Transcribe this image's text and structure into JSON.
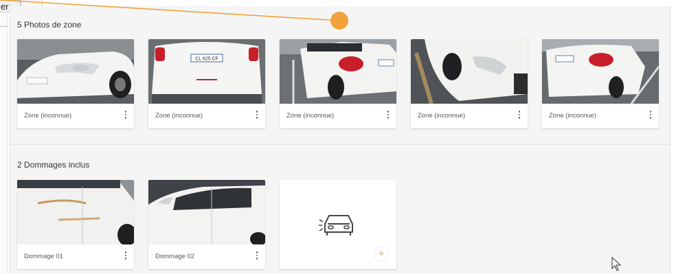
{
  "browser_stub": {
    "tab_fragment": "er"
  },
  "zone_photos": {
    "title": "5 Photos de zone",
    "cards": [
      {
        "label": "Zone (inconnue)"
      },
      {
        "label": "Zone (inconnue)"
      },
      {
        "label": "Zone (inconnue)"
      },
      {
        "label": "Zone (inconnue)"
      },
      {
        "label": "Zone (inconnue)"
      }
    ]
  },
  "damages": {
    "title": "2 Dommages inclus",
    "cards": [
      {
        "label": "Dommage 01"
      },
      {
        "label": "Dommage 02"
      }
    ],
    "add_button_label": "+"
  },
  "colors": {
    "accent": "#f2a23a",
    "panel_bg": "#f5f5f5",
    "card_bg": "#ffffff"
  },
  "icons": [
    "car-front-icon",
    "plus-icon",
    "kebab-menu-icon",
    "mouse-cursor-icon"
  ]
}
